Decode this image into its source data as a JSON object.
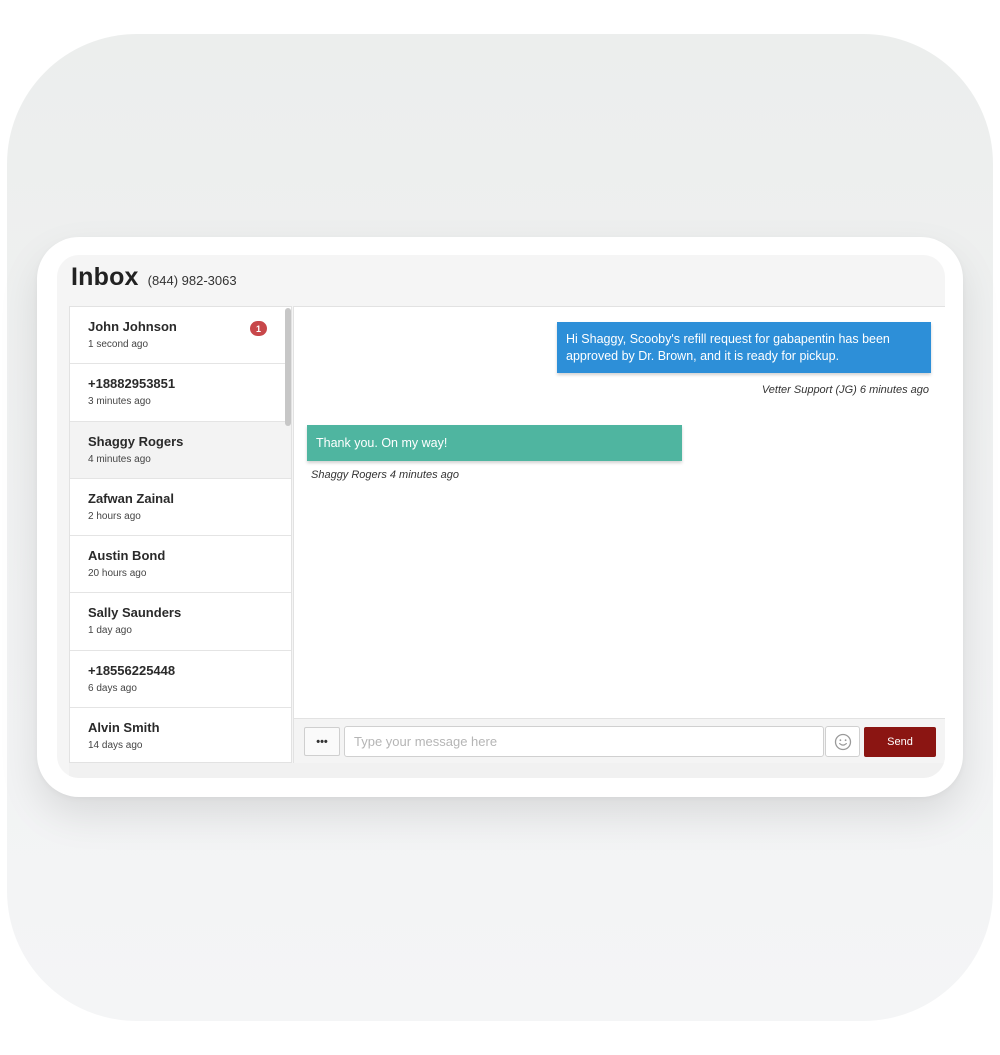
{
  "header": {
    "title": "Inbox",
    "phone": "(844) 982-3063"
  },
  "contacts": [
    {
      "name": "John Johnson",
      "time": "1 second ago",
      "badge": "1"
    },
    {
      "name": "+18882953851",
      "time": "3 minutes ago"
    },
    {
      "name": "Shaggy Rogers",
      "time": "4 minutes ago",
      "active": true
    },
    {
      "name": "Zafwan Zainal",
      "time": "2 hours ago"
    },
    {
      "name": "Austin Bond",
      "time": "20 hours ago"
    },
    {
      "name": "Sally Saunders",
      "time": "1 day ago"
    },
    {
      "name": "+18556225448",
      "time": "6 days ago"
    },
    {
      "name": "Alvin Smith",
      "time": "14 days ago"
    }
  ],
  "messages": {
    "outgoing": {
      "text": "Hi Shaggy, Scooby's refill request for gabapentin has been approved by Dr. Brown, and it is ready for pickup.",
      "meta": "Vetter Support (JG) 6 minutes ago",
      "color": "#2d8fd8"
    },
    "incoming": {
      "text": "Thank you. On my way!",
      "meta": "Shaggy Rogers 4 minutes ago",
      "color": "#4fb5a0"
    }
  },
  "composer": {
    "more_label": "•••",
    "placeholder": "Type your message here",
    "value": "",
    "emoji_icon": "smiley-icon",
    "send_label": "Send",
    "send_color": "#8b1512"
  },
  "colors": {
    "badge": "#c8474a"
  }
}
